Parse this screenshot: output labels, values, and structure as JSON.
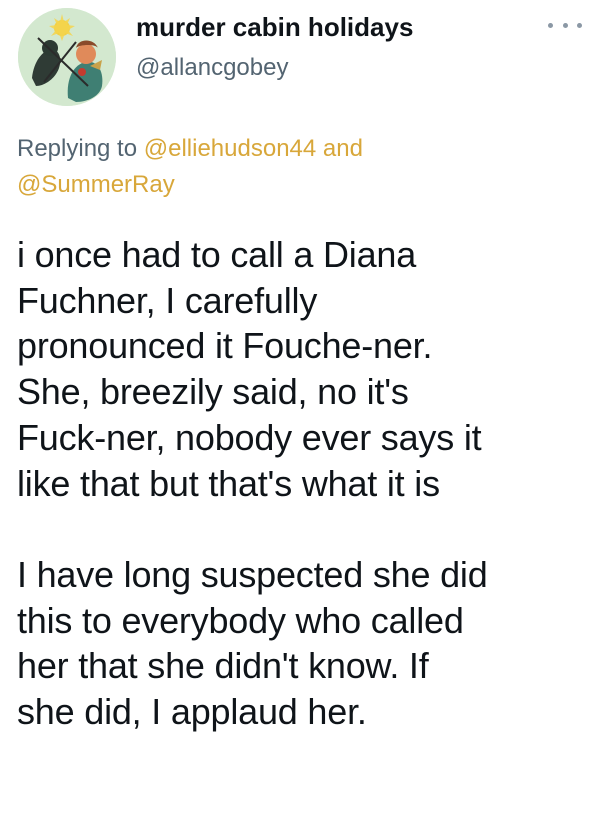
{
  "author": {
    "display_name": "murder cabin holidays",
    "handle": "@allancgobey",
    "avatar_icon": "illustrated-avatar-icon"
  },
  "more_icon": "more-options-icon",
  "reply": {
    "prefix": "Replying to",
    "mention_1": "@elliehudson44",
    "joiner": "and",
    "mention_2": "@SummerRay",
    "mention_color": "#d8a73a"
  },
  "tweet_text": {
    "paragraph_1_lines": [
      "i once had to call a Diana",
      "Fuchner, I carefully",
      "pronounced it Fouche-ner.",
      "She, breezily said, no it's",
      "Fuck-ner, nobody ever says it",
      "like that but that's what it is"
    ],
    "paragraph_2_lines": [
      "I have long suspected she did",
      "this to everybody who called",
      "her that she didn't know. If",
      "she did, I applaud her."
    ]
  }
}
